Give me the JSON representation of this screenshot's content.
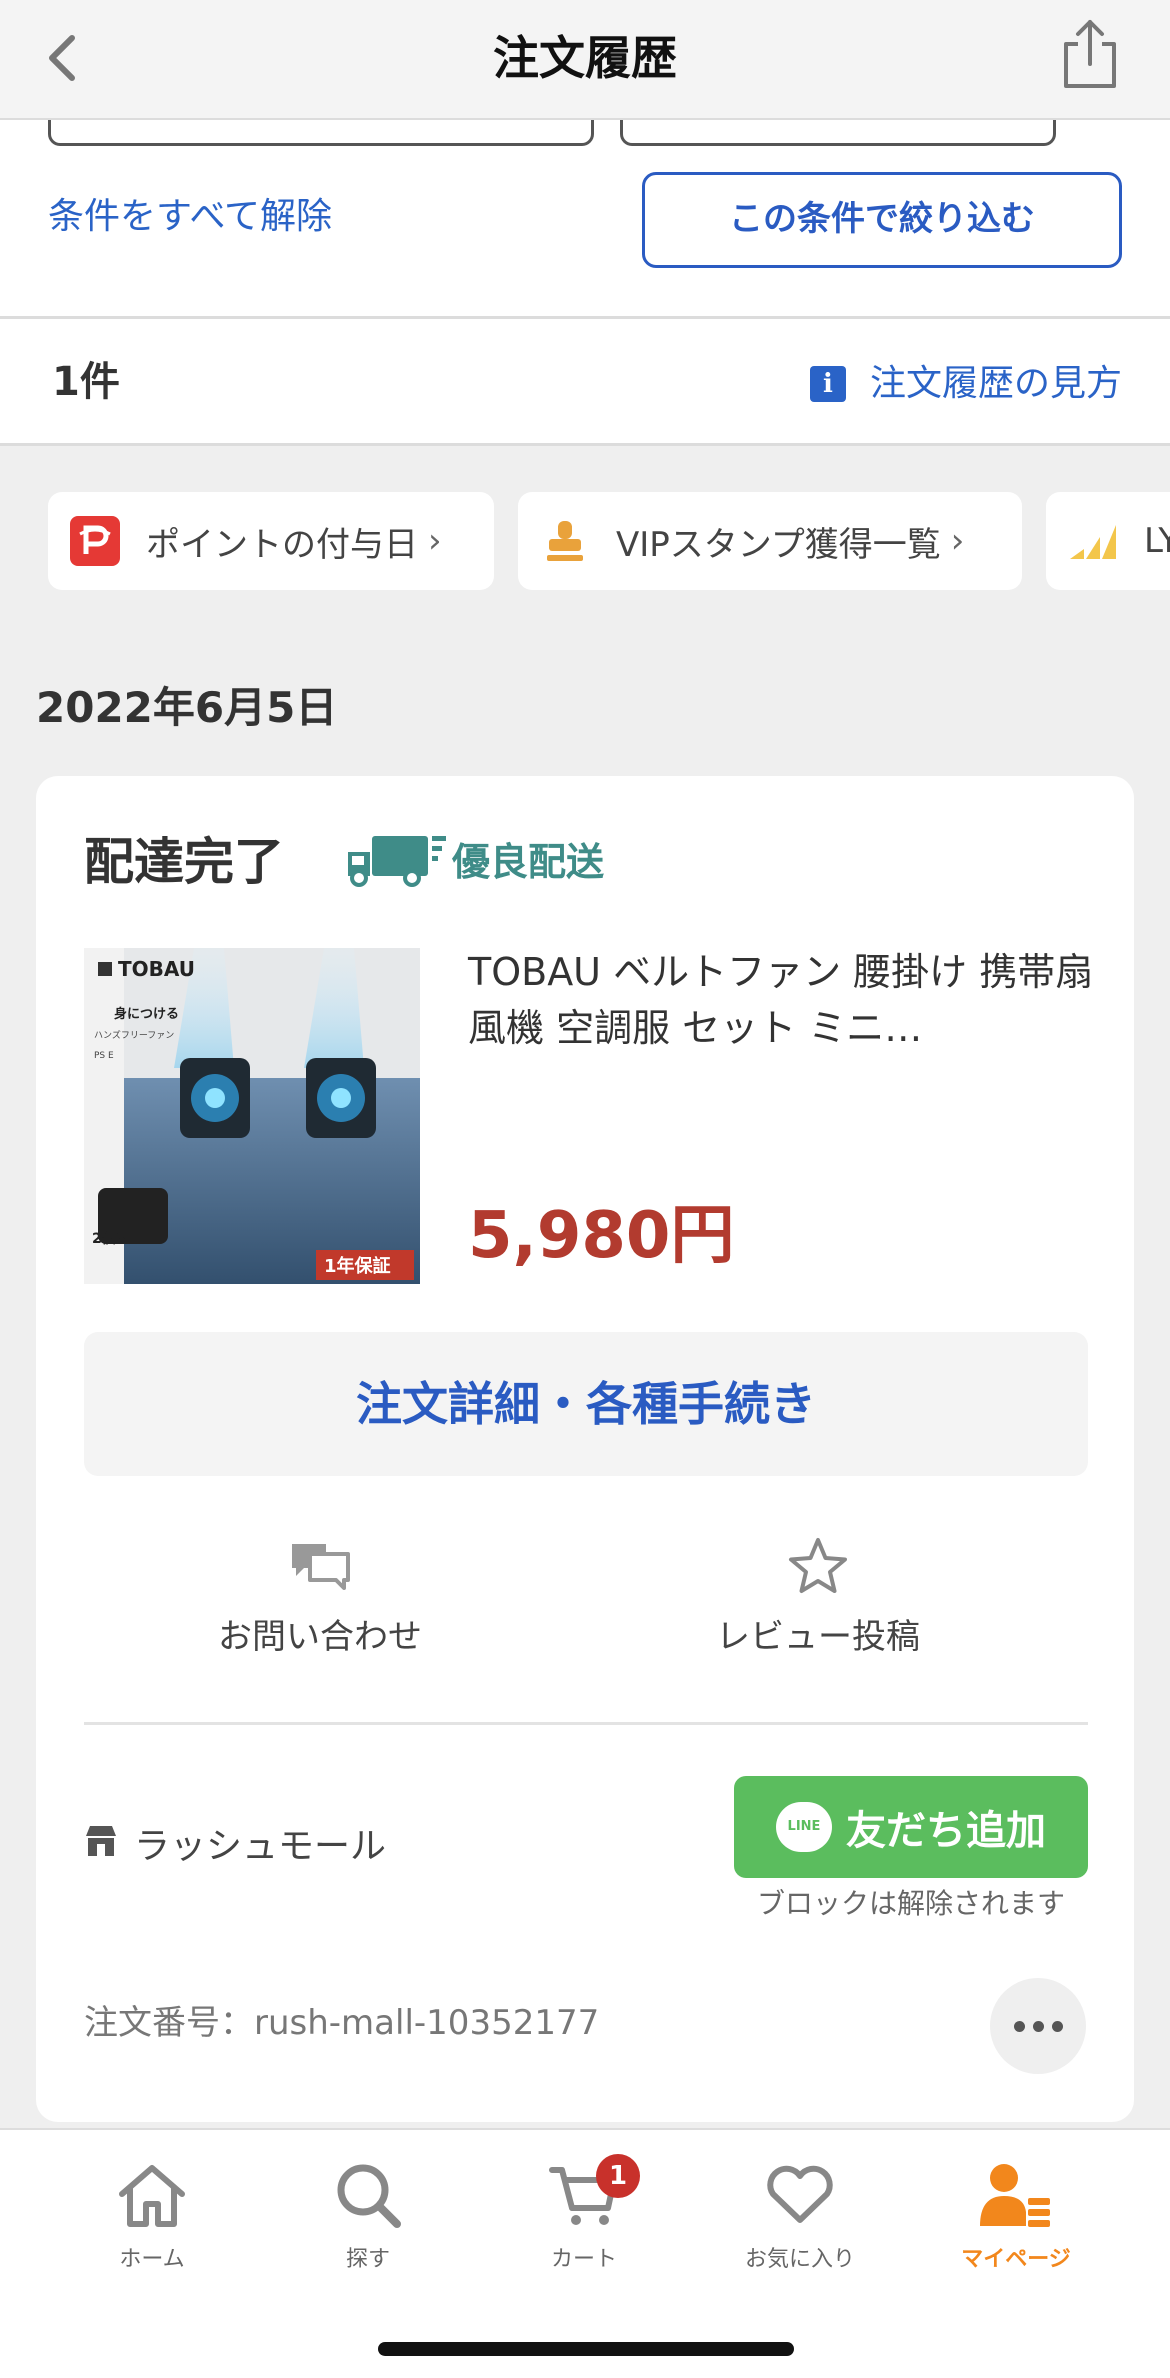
{
  "header": {
    "title": "注文履歴"
  },
  "filter": {
    "clear_label": "条件をすべて解除",
    "apply_label": "この条件で絞り込む"
  },
  "results": {
    "count": "1件",
    "howto_label": "注文履歴の見方"
  },
  "chips": [
    {
      "label": "ポイントの付与日",
      "icon": "paypay-icon"
    },
    {
      "label": "VIPスタンプ獲得一覧",
      "icon": "stamp-icon"
    },
    {
      "label": "LY",
      "icon": "signal-bars-icon"
    }
  ],
  "order": {
    "date": "2022年6月5日",
    "status": "配達完了",
    "delivery_badge": "優良配送",
    "product_name": "TOBAU ベルトファン 腰掛け 携帯扇風機 空調服 セット ミニ…",
    "thumbnail": {
      "brand": "TOBAU",
      "tag_sets": "2個SET",
      "tag_warranty": "1年保証",
      "side_text": "身につける",
      "side_text2": "ハンズフリーファン",
      "ps_mark": "PS E"
    },
    "price": "5,980円",
    "detail_button": "注文詳細・各種手続き",
    "actions": {
      "inquiry": "お問い合わせ",
      "review": "レビュー投稿"
    },
    "store_name": "ラッシュモール",
    "line_button": "友だち追加",
    "line_badge": "LINE",
    "line_note": "ブロックは解除されます",
    "order_number": "注文番号：rush-mall-10352177"
  },
  "tabbar": {
    "home": "ホーム",
    "search": "探す",
    "cart": "カート",
    "cart_badge": "1",
    "favorites": "お気に入り",
    "mypage": "マイページ"
  },
  "colors": {
    "link": "#2a63c7",
    "price": "#b23b2f",
    "line_green": "#5bbd5e",
    "active_tab": "#f2871c",
    "delivery": "#3f8c88"
  }
}
